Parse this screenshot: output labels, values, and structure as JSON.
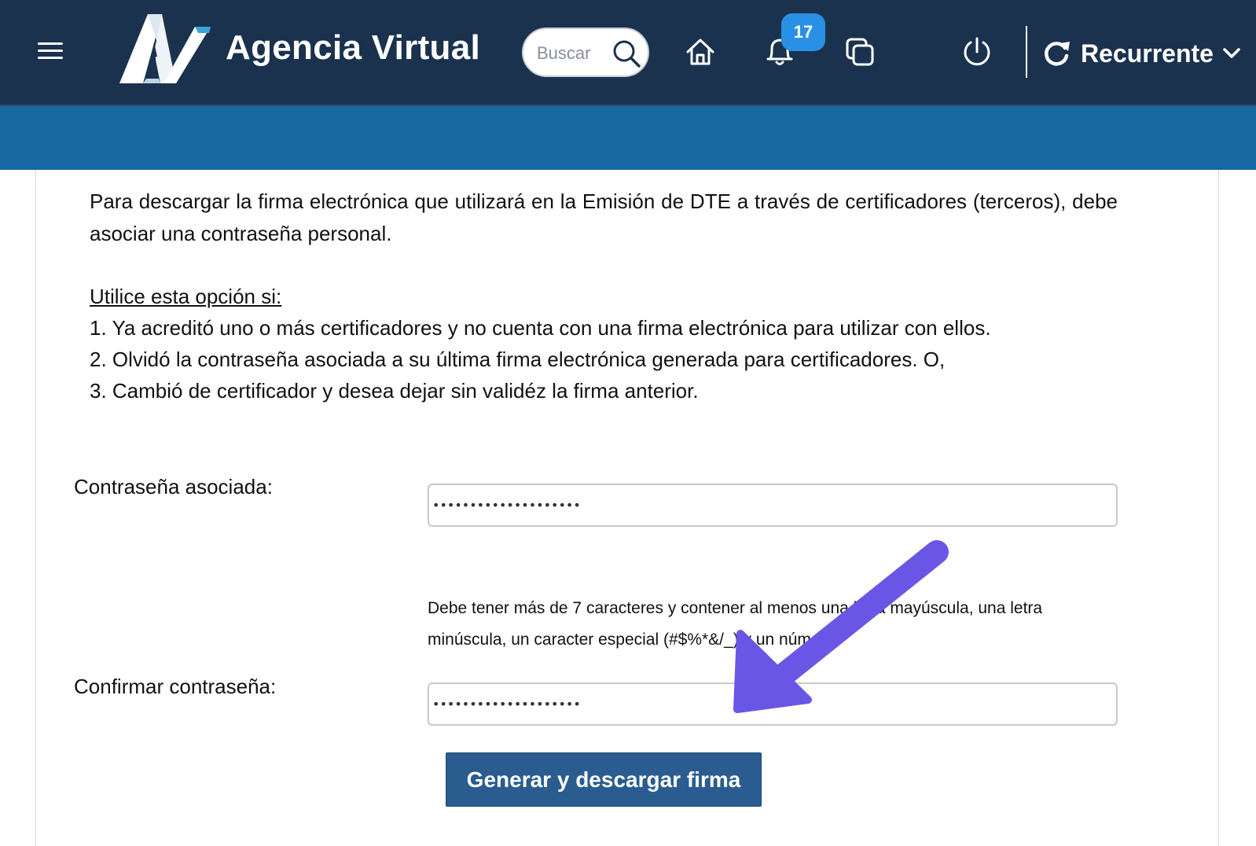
{
  "header": {
    "title": "Agencia Virtual",
    "search_placeholder": "Buscar",
    "notifications_count": "17",
    "profile_label": "Recurrente"
  },
  "content": {
    "intro": "Para descargar la firma electrónica que utilizará en la Emisión de DTE a través de certificadores (terceros), debe asociar una contraseña personal.",
    "options_title": "Utilice esta opción si:",
    "options": [
      "1. Ya acreditó uno o más certificadores y no cuenta con una firma electrónica para utilizar con ellos.",
      "2. Olvidó la contraseña asociada a su última firma electrónica generada para certificadores. O,",
      "3. Cambió de certificador y desea dejar sin validéz la firma anterior."
    ]
  },
  "form": {
    "password_label": "Contraseña asociada:",
    "password_value": "••••••••••••••••••••",
    "hint": "Debe tener más de 7 caracteres y contener al menos una letra mayúscula, una letra minúscula, un caracter especial (#$%*&/_) y un número.",
    "confirm_label": "Confirmar contraseña:",
    "confirm_value": "••••••••••••••••••••",
    "submit_label": "Generar y descargar firma"
  },
  "colors": {
    "header_bg": "#1b324e",
    "subheader_bg": "#1769a2",
    "badge": "#2891e6",
    "button": "#2a5c8f",
    "annotation_arrow": "#6a56e6"
  },
  "icons": [
    "menu-icon",
    "agencia-virtual-logo",
    "search-icon",
    "home-icon",
    "bell-icon",
    "windows-icon",
    "power-icon",
    "recurrent-icon",
    "chevron-down-icon",
    "annotation-arrow"
  ]
}
